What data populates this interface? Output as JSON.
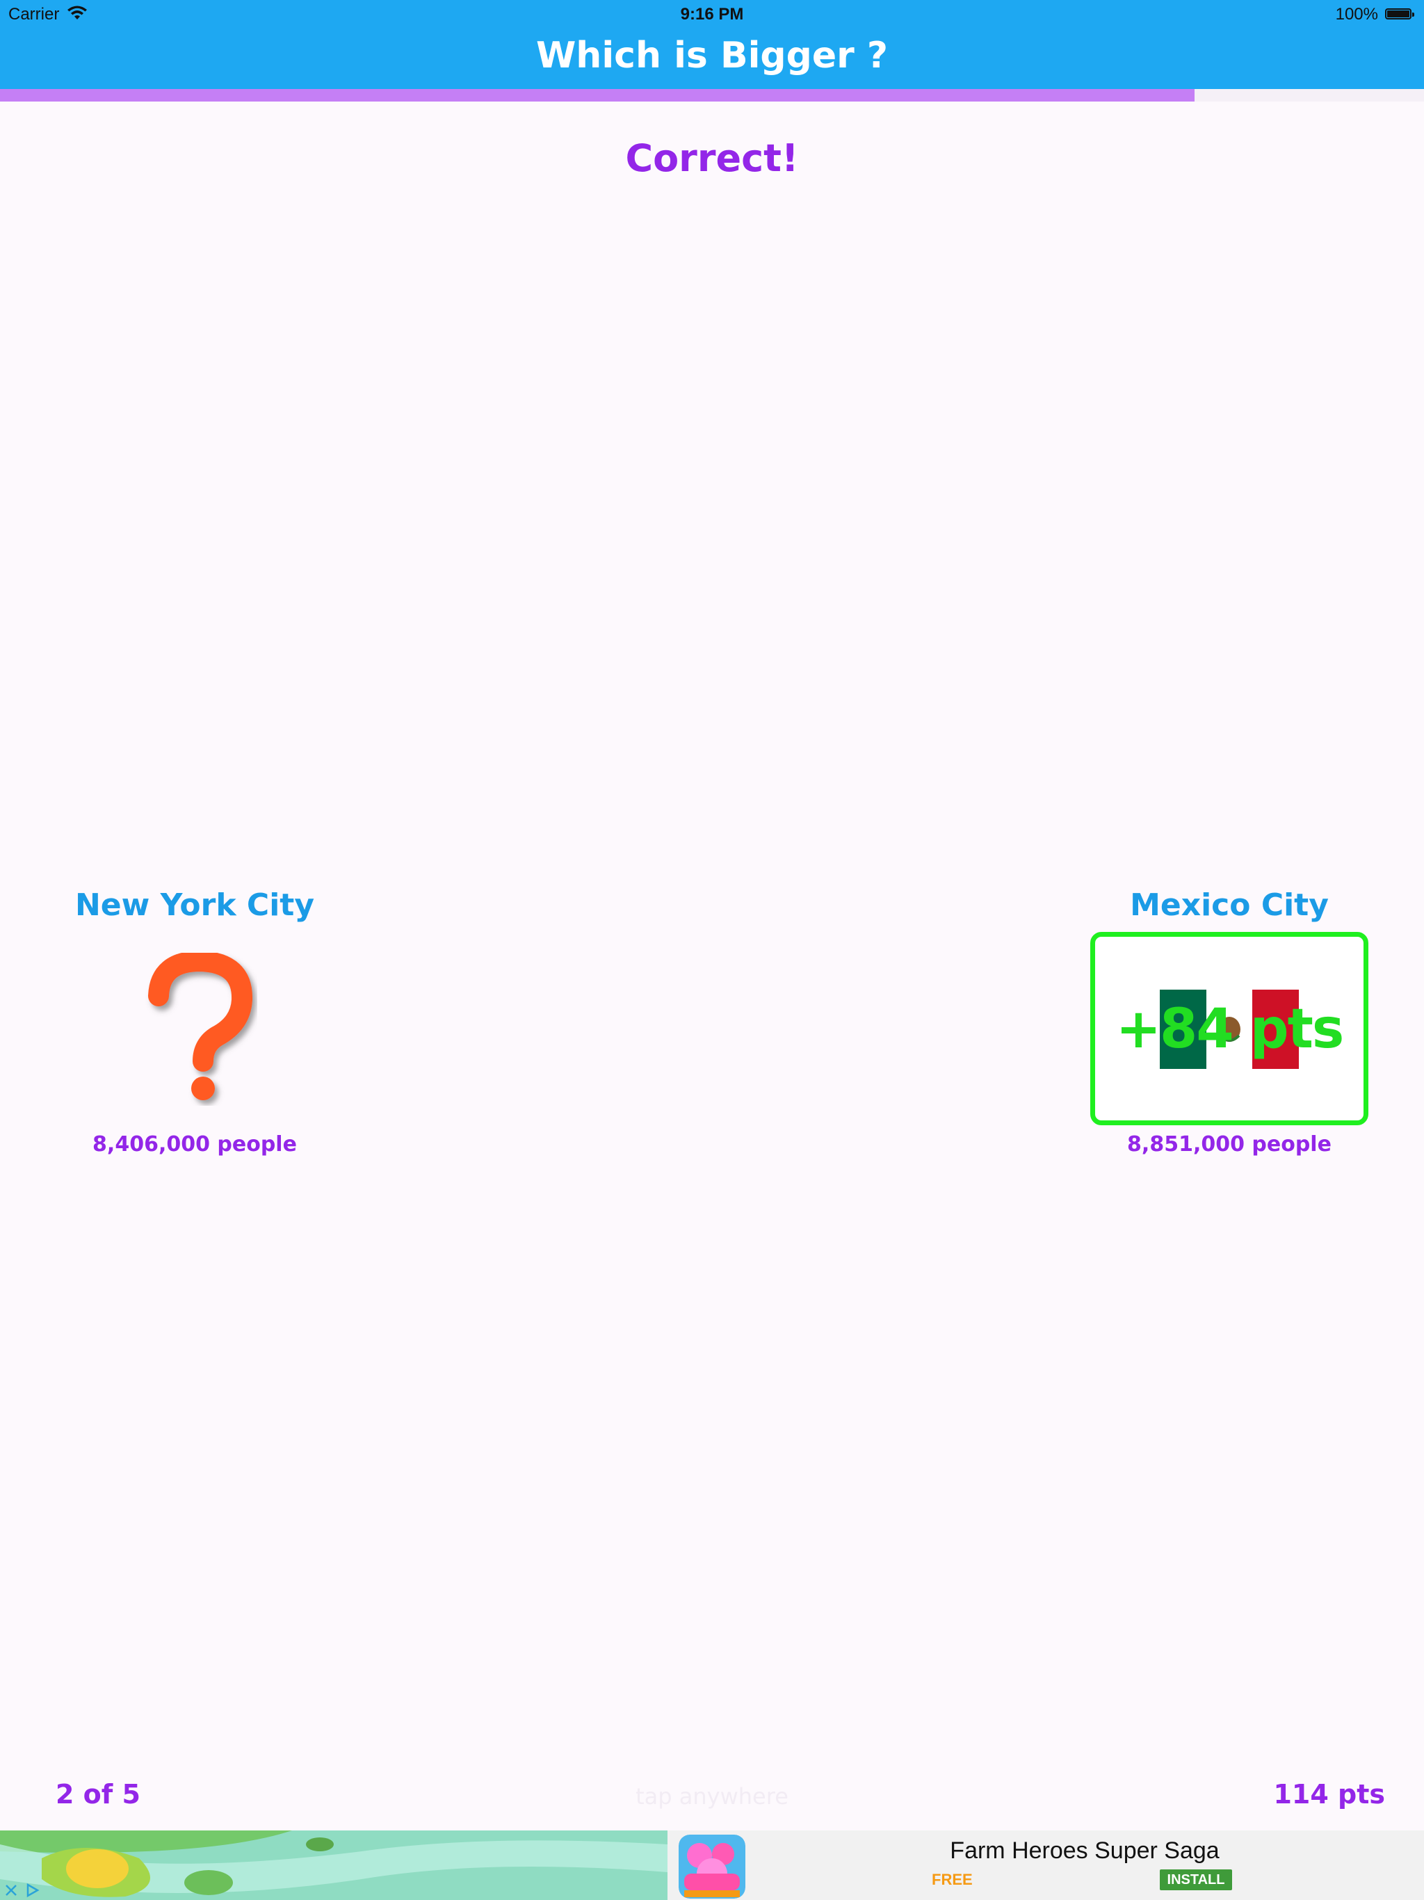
{
  "status_bar": {
    "carrier": "Carrier",
    "time": "9:16 PM",
    "battery": "100%"
  },
  "header": {
    "title": "Which is Bigger ?"
  },
  "progress": {
    "fraction": 0.839
  },
  "result": {
    "text": "Correct!"
  },
  "cities": {
    "left": {
      "name": "New York City",
      "population": "8,406,000 people",
      "icon": "question-mark-icon"
    },
    "right": {
      "name": "Mexico City",
      "population": "8,851,000 people",
      "icon": "mexico-flag-icon",
      "points": "+84 pts"
    }
  },
  "footer": {
    "round": "2 of 5",
    "hint": "tap anywhere",
    "score": "114 pts"
  },
  "ad": {
    "app_name": "Farm Heroes Super Saga",
    "price": "FREE",
    "install": "INSTALL"
  },
  "colors": {
    "header": "#1ea8f2",
    "progress": "#c57ff5",
    "accent_purple": "#9326e8",
    "city_blue": "#1b9be6",
    "correct_green": "#1fef1f"
  }
}
